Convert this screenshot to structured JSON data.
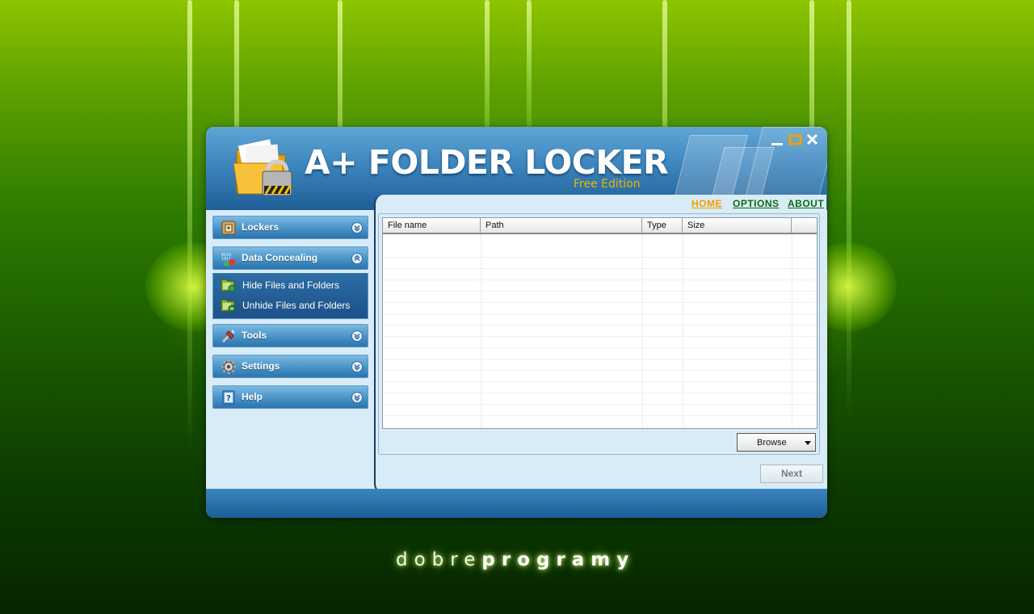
{
  "window": {
    "app_title": "A+ FOLDER LOCKER",
    "edition": "Free Edition"
  },
  "nav": {
    "home": "HOME",
    "options": "OPTIONS",
    "about": "ABOUT"
  },
  "sidebar": {
    "lockers": "Lockers",
    "data_concealing": "Data Concealing",
    "hide_files": "Hide Files and Folders",
    "unhide_files": "Unhide Files and Folders",
    "tools": "Tools",
    "settings": "Settings",
    "help": "Help"
  },
  "table": {
    "columns": [
      "File name",
      "Path",
      "Type",
      "Size"
    ],
    "rows": []
  },
  "buttons": {
    "browse": "Browse",
    "next": "Next"
  },
  "brand": {
    "part1": "dobre",
    "part2": "programy"
  },
  "colors": {
    "accent_orange": "#f29b00",
    "link_green": "#0b6a10",
    "header_blue": "#3d86be"
  }
}
